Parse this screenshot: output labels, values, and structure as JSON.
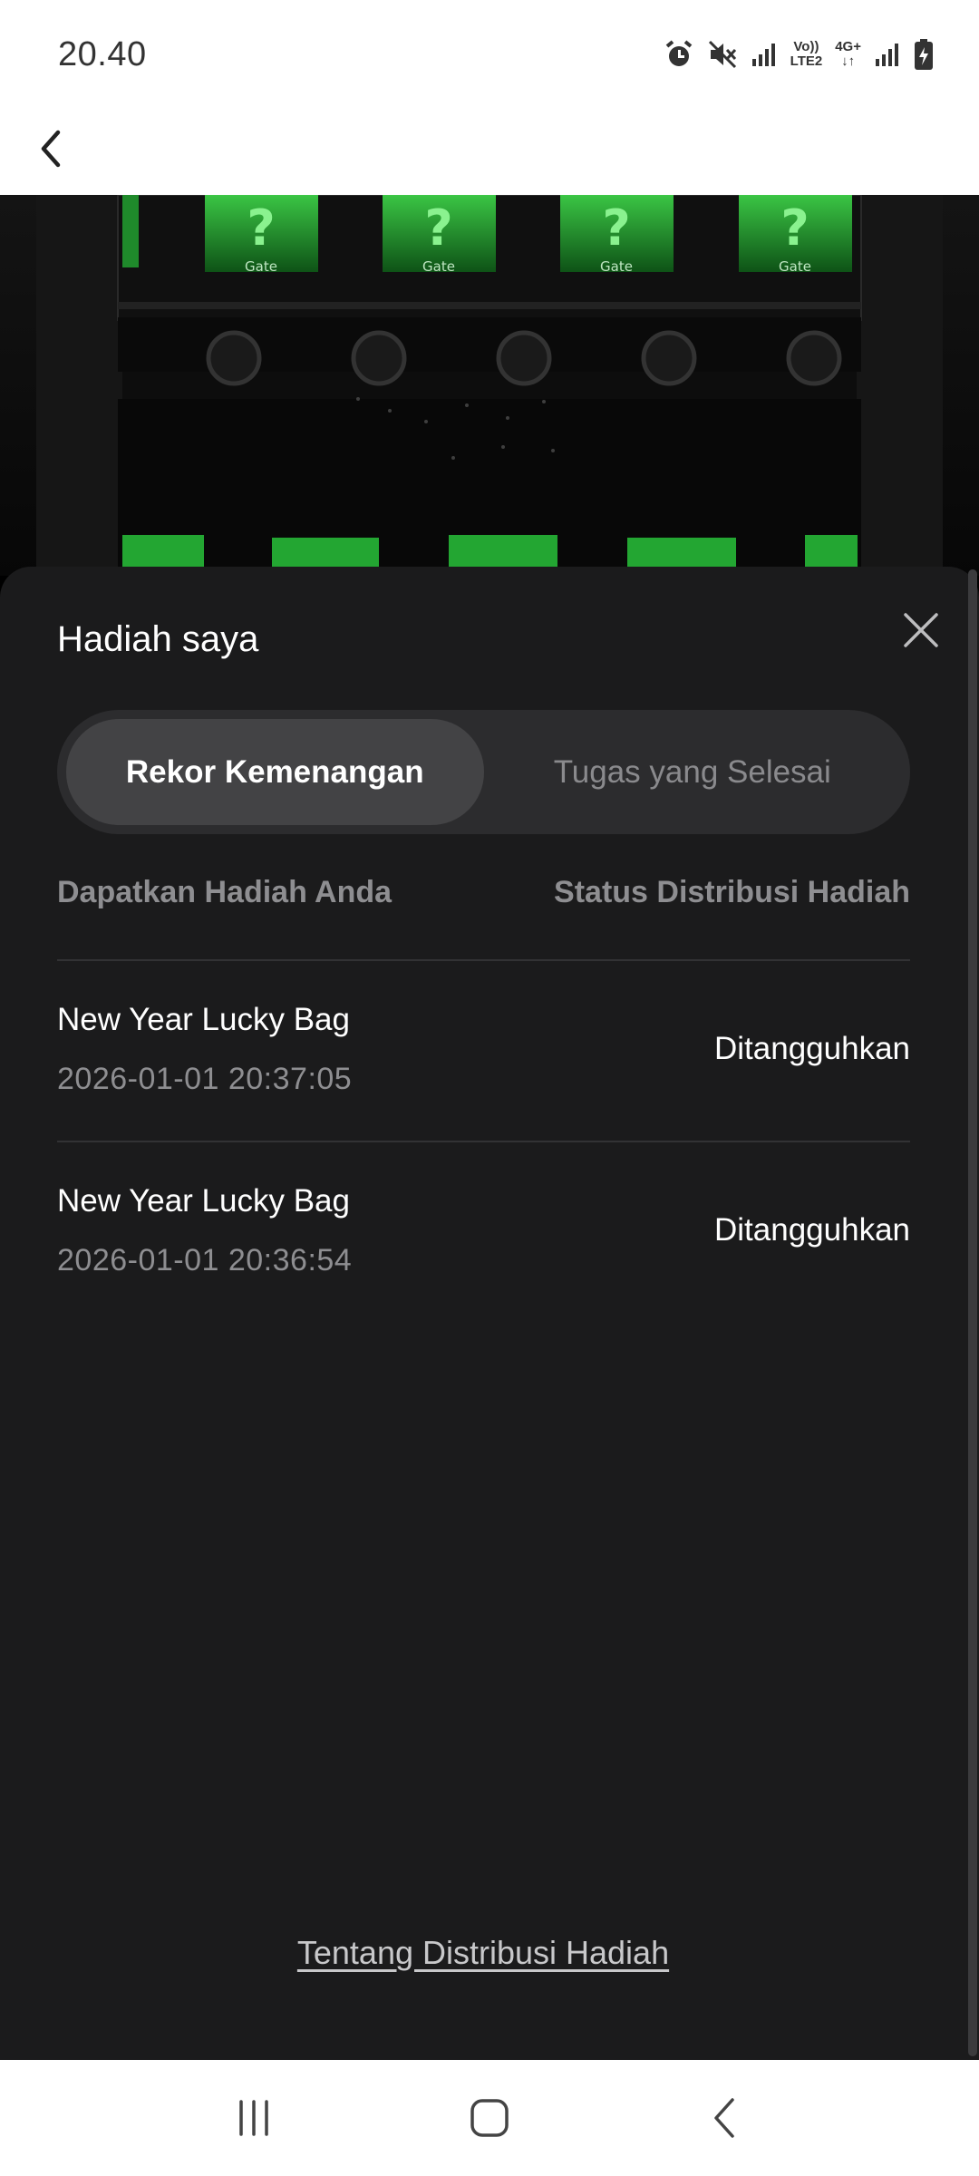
{
  "status_bar": {
    "time": "20.40",
    "volte_label_top": "Vo))",
    "volte_label_bottom": "LTE2",
    "network_label": "4G+",
    "icons": [
      "alarm-icon",
      "mute-icon",
      "signal-icon",
      "volte-icon",
      "data-arrows-icon",
      "signal-icon",
      "battery-charging-icon"
    ]
  },
  "header": {
    "back_icon": "chevron-left-icon"
  },
  "background": {
    "accent_color": "#2ecc40",
    "box_label": "Gate",
    "box_symbol": "?"
  },
  "sheet": {
    "title": "Hadiah saya",
    "close_icon": "close-icon",
    "tabs": [
      {
        "label": "Rekor Kemenangan",
        "active": true
      },
      {
        "label": "Tugas yang Selesai",
        "active": false
      }
    ],
    "columns": {
      "left": "Dapatkan Hadiah Anda",
      "right": "Status Distribusi Hadiah"
    },
    "rewards": [
      {
        "name": "New Year Lucky Bag",
        "time": "2026-01-01 20:37:05",
        "status": "Ditangguhkan"
      },
      {
        "name": "New Year Lucky Bag",
        "time": "2026-01-01 20:36:54",
        "status": "Ditangguhkan"
      }
    ],
    "footer_link": "Tentang Distribusi Hadiah"
  },
  "nav_bar": {
    "icons": [
      "recent-apps-icon",
      "home-icon",
      "back-icon"
    ]
  },
  "colors": {
    "sheet_bg": "#1b1b1c",
    "segment_bg": "#2c2c2e",
    "segment_active": "#434345",
    "muted_text": "#8e8e91"
  }
}
